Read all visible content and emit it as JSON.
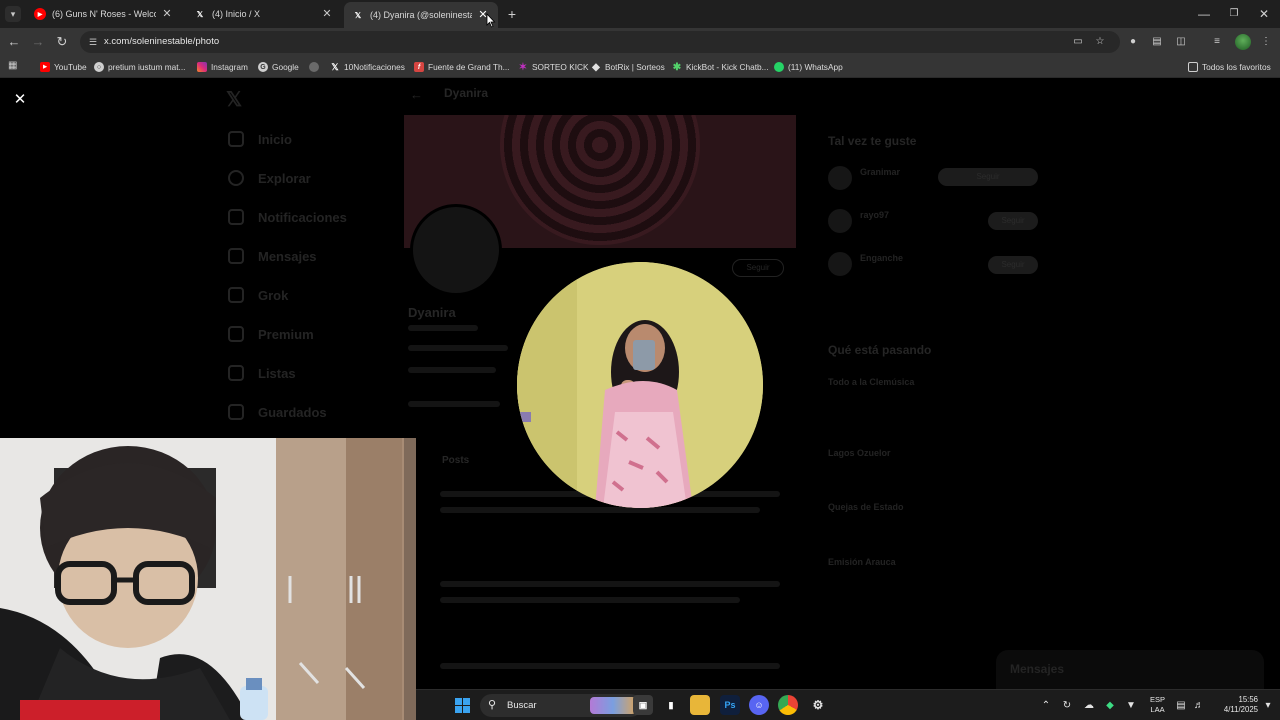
{
  "browser": {
    "tabs": [
      {
        "label": "(6) Guns N' Roses - Welcome To",
        "favicon": "youtube-icon",
        "active": false
      },
      {
        "label": "(4) Inicio / X",
        "favicon": "x-icon",
        "active": false
      },
      {
        "label": "(4) Dyanira (@soleninestable) /",
        "favicon": "x-icon",
        "active": true
      }
    ],
    "url": "x.com/soleninestable/photo",
    "bookmarks": [
      {
        "label": "YouTube",
        "icon": "youtube-icon",
        "color": "#ff0000"
      },
      {
        "label": "pretium iustum mat...",
        "icon": "chrome-icon",
        "color": "#cfcfcf"
      },
      {
        "label": "Instagram",
        "icon": "instagram-icon",
        "color": "#d62976"
      },
      {
        "label": "Google",
        "icon": "google-icon",
        "color": "#cfcfcf"
      },
      {
        "label": "",
        "icon": "globe-icon",
        "color": "#9a9a9a"
      },
      {
        "label": "10Notificaciones",
        "icon": "x-icon",
        "color": "#000000"
      },
      {
        "label": "Fuente de Grand Th...",
        "icon": "font-icon",
        "color": "#d64541"
      },
      {
        "label": "SORTEO KICK",
        "icon": "star-icon",
        "color": "#c030c0"
      },
      {
        "label": "BotRix | Sorteos",
        "icon": "diamond-icon",
        "color": "#e0e0e0"
      },
      {
        "label": "KickBot - Kick Chatb...",
        "icon": "kickbot-icon",
        "color": "#53d16a"
      },
      {
        "label": "(11) WhatsApp",
        "icon": "whatsapp-icon",
        "color": "#25d366"
      }
    ],
    "all_bookmarks_label": "Todos los favoritos"
  },
  "profile_page": {
    "header_name": "Dyanira",
    "name": "Dyanira",
    "follow_button": "Seguir",
    "nav": [
      "Inicio",
      "Explorar",
      "Notificaciones",
      "Mensajes",
      "Grok",
      "Premium",
      "Listas",
      "Guardados"
    ],
    "posts_tab": "Posts",
    "right": {
      "suggestions_title": "Tal vez te guste",
      "follow_label": "Seguir",
      "suggestions": [
        "Granimar",
        "rayo97",
        "Enganche"
      ],
      "trending_title": "Qué está pasando",
      "trends": [
        "Todo a la Clemúsica",
        "Lagos Ozuelor",
        "Quejas de Estado",
        "Emisión Arauca"
      ]
    },
    "messages_drawer": "Mensajes"
  },
  "taskbar": {
    "search_label": "Buscar",
    "lang_top": "ESP",
    "lang_bottom": "LAA",
    "time": "15:56",
    "date": "4/11/2025"
  }
}
